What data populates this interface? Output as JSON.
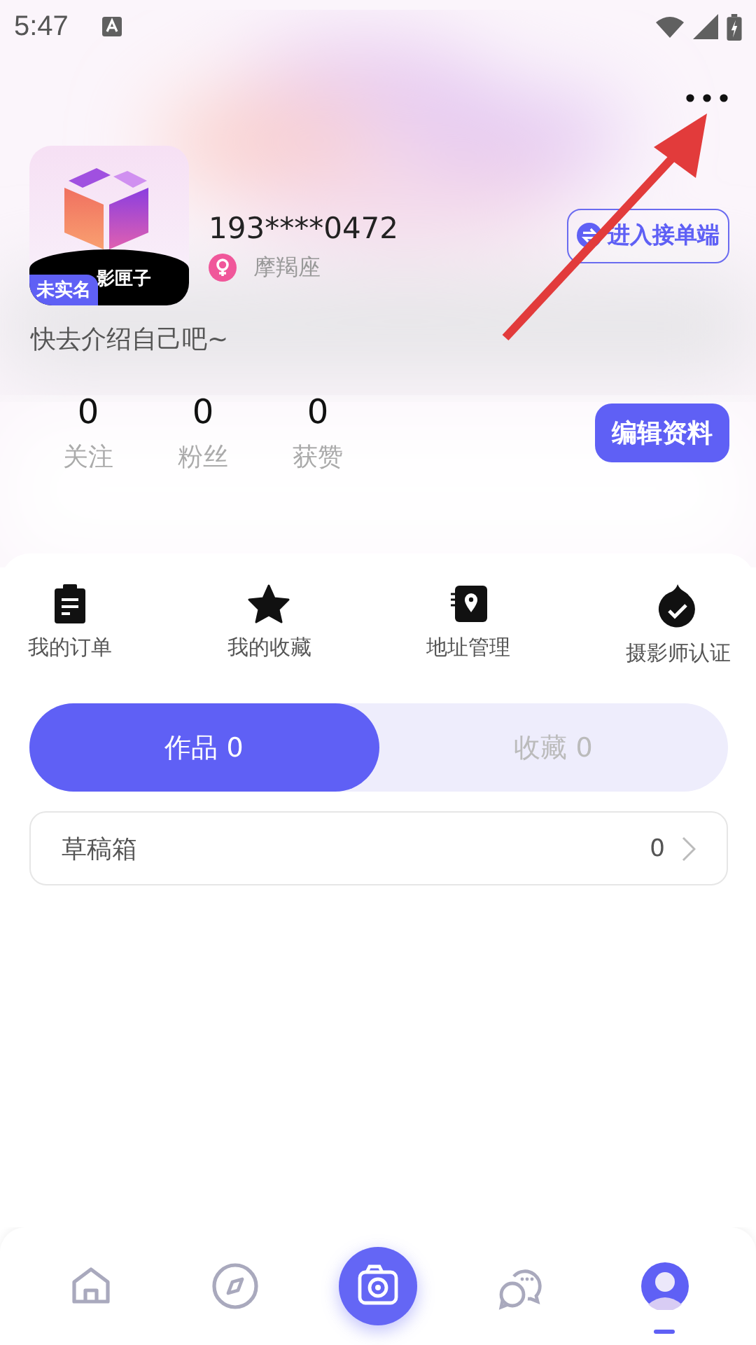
{
  "status_bar": {
    "time": "5:47"
  },
  "profile": {
    "logo_text": "影匣子",
    "badge": "未实名",
    "phone": "193****0472",
    "zodiac": "摩羯座",
    "bio": "快去介绍自己吧~",
    "switch_button": "进入接单端",
    "edit_button": "编辑资料"
  },
  "stats": [
    {
      "value": "0",
      "label": "关注"
    },
    {
      "value": "0",
      "label": "粉丝"
    },
    {
      "value": "0",
      "label": "获赞"
    }
  ],
  "shortcuts": [
    {
      "kind": "orders",
      "label": "我的订单"
    },
    {
      "kind": "favorites",
      "label": "我的收藏"
    },
    {
      "kind": "address",
      "label": "地址管理"
    },
    {
      "kind": "certify",
      "label": "摄影师认证"
    }
  ],
  "tabs": [
    {
      "label": "作品 0",
      "selected": true
    },
    {
      "label": "收藏 0",
      "selected": false
    }
  ],
  "drafts": {
    "label": "草稿箱",
    "count": "0"
  },
  "bottom_nav": [
    {
      "kind": "home",
      "selected": false
    },
    {
      "kind": "discover",
      "selected": false
    },
    {
      "kind": "camera",
      "selected": false
    },
    {
      "kind": "messages",
      "selected": false
    },
    {
      "kind": "profile",
      "selected": true
    }
  ]
}
